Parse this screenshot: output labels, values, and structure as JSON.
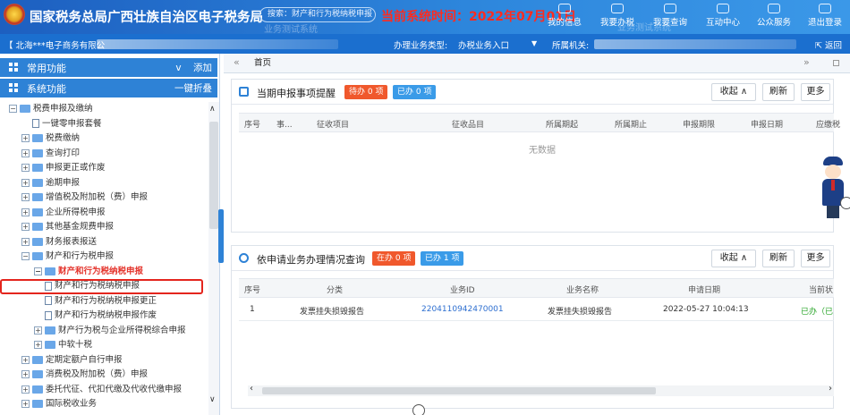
{
  "header": {
    "title": "国家税务总局广西壮族自治区电子税务局",
    "search_placeholder": "搜索：财产和行为税纳税申报",
    "watermark": "业务测试系统",
    "time_label": "当前系统时间：2022年07月01日",
    "nav": [
      {
        "label": "我的信息",
        "icon": "user-icon"
      },
      {
        "label": "我要办税",
        "icon": "tax-icon"
      },
      {
        "label": "我要查询",
        "icon": "query-icon"
      },
      {
        "label": "互动中心",
        "icon": "chat-icon"
      },
      {
        "label": "公众服务",
        "icon": "service-icon"
      },
      {
        "label": "退出登录",
        "icon": "logout-icon"
      }
    ]
  },
  "subbar": {
    "taxpayer": "【 北海***电子商务有限公",
    "biz_type_label": "办理业务类型:",
    "biz_type_value": "办税业务入口",
    "org_label": "所属机关:",
    "back_label": "返回"
  },
  "left": {
    "common_title": "常用功能",
    "common_action": "添加",
    "common_caret": "v",
    "system_title": "系统功能",
    "system_action": "一键折叠",
    "tree": [
      {
        "label": "税费申报及缴纳",
        "level": 0,
        "toggle": "−",
        "type": "folder"
      },
      {
        "label": "一键零申报套餐",
        "level": 1,
        "toggle": "",
        "type": "doc"
      },
      {
        "label": "税费缴纳",
        "level": 1,
        "toggle": "+",
        "type": "folder"
      },
      {
        "label": "查询打印",
        "level": 1,
        "toggle": "+",
        "type": "folder"
      },
      {
        "label": "申报更正或作废",
        "level": 1,
        "toggle": "+",
        "type": "folder"
      },
      {
        "label": "逾期申报",
        "level": 1,
        "toggle": "+",
        "type": "folder"
      },
      {
        "label": "增值税及附加税（费）申报",
        "level": 1,
        "toggle": "+",
        "type": "folder"
      },
      {
        "label": "企业所得税申报",
        "level": 1,
        "toggle": "+",
        "type": "folder"
      },
      {
        "label": "其他基金规费申报",
        "level": 1,
        "toggle": "+",
        "type": "folder"
      },
      {
        "label": "财务报表报送",
        "level": 1,
        "toggle": "+",
        "type": "folder"
      },
      {
        "label": "财产和行为税申报",
        "level": 1,
        "toggle": "−",
        "type": "folder"
      },
      {
        "label": "财产和行为税纳税申报",
        "level": 2,
        "toggle": "−",
        "type": "folder",
        "style": "red"
      },
      {
        "label": "财产和行为税纳税申报",
        "level": 3,
        "toggle": "",
        "type": "doc",
        "style": "hl"
      },
      {
        "label": "财产和行为税纳税申报更正",
        "level": 3,
        "toggle": "",
        "type": "doc"
      },
      {
        "label": "财产和行为税纳税申报作废",
        "level": 3,
        "toggle": "",
        "type": "doc"
      },
      {
        "label": "财产行为税与企业所得税综合申报",
        "level": 2,
        "toggle": "+",
        "type": "folder"
      },
      {
        "label": "中软十税",
        "level": 2,
        "toggle": "+",
        "type": "folder"
      },
      {
        "label": "定期定额户自行申报",
        "level": 1,
        "toggle": "+",
        "type": "folder"
      },
      {
        "label": "消费税及附加税（费）申报",
        "level": 1,
        "toggle": "+",
        "type": "folder"
      },
      {
        "label": "委托代征、代扣代缴及代收代缴申报",
        "level": 1,
        "toggle": "+",
        "type": "folder"
      },
      {
        "label": "国际税收业务",
        "level": 1,
        "toggle": "+",
        "type": "folder"
      }
    ]
  },
  "tabs": {
    "home": "首页",
    "prev": "«",
    "next": "»"
  },
  "panel1": {
    "title": "当期申报事项提醒",
    "badge_todo": "待办 0 项",
    "badge_done": "已办 0 项",
    "btn_collapse": "收起 ∧",
    "btn_refresh": "刷新",
    "btn_more": "更多",
    "columns": [
      "序号",
      "事...",
      "征收项目",
      "征收品目",
      "所属期起",
      "所属期止",
      "申报期限",
      "申报日期",
      "应缴税"
    ],
    "empty": "无数据"
  },
  "panel2": {
    "title": "依申请业务办理情况查询",
    "badge_doing": "在办 0 项",
    "badge_done": "已办 1 项",
    "btn_collapse": "收起 ∧",
    "btn_refresh": "刷新",
    "btn_more": "更多",
    "columns": [
      "序号",
      "分类",
      "业务ID",
      "业务名称",
      "申请日期",
      "当前状"
    ],
    "rows": [
      [
        "1",
        "发票挂失损毁报告",
        "2204110942470001",
        "发票挂失损毁报告",
        "2022-05-27 10:04:13",
        "已办（已"
      ]
    ]
  },
  "colors": {
    "header_blue": "#1d5fc0",
    "accent_blue": "#2e82d6",
    "red": "#e4322a",
    "badge_orange": "#f0582c",
    "badge_blue": "#3a9be8",
    "link": "#2e6fd0",
    "status_green": "#2aa52a"
  }
}
